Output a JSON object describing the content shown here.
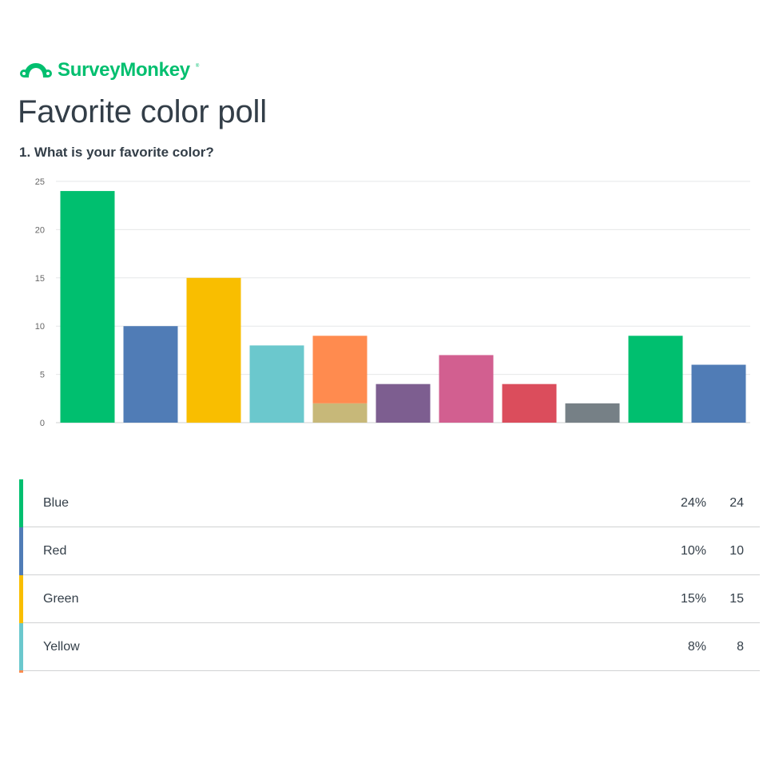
{
  "brand": {
    "name": "SurveyMonkey",
    "trademark": "®",
    "color": "#00bf6f"
  },
  "survey": {
    "title": "Favorite color poll",
    "question": "1. What is your favorite color?"
  },
  "chart_data": {
    "type": "bar",
    "stacked": true,
    "ylim": [
      0,
      25
    ],
    "yticks": [
      0,
      5,
      10,
      15,
      20,
      25
    ],
    "grid": true,
    "bars": [
      {
        "segments": [
          {
            "value": 24,
            "color": "#00bf6f"
          }
        ]
      },
      {
        "segments": [
          {
            "value": 10,
            "color": "#507cb6"
          }
        ]
      },
      {
        "segments": [
          {
            "value": 15,
            "color": "#f9be00"
          }
        ]
      },
      {
        "segments": [
          {
            "value": 8,
            "color": "#6bc8cd"
          }
        ]
      },
      {
        "segments": [
          {
            "value": 2,
            "color": "#c7b879"
          },
          {
            "value": 7,
            "color": "#ff8b4f"
          }
        ]
      },
      {
        "segments": [
          {
            "value": 4,
            "color": "#7d5e90"
          }
        ]
      },
      {
        "segments": [
          {
            "value": 7,
            "color": "#d25f90"
          }
        ]
      },
      {
        "segments": [
          {
            "value": 4,
            "color": "#db4d5c"
          }
        ]
      },
      {
        "segments": [
          {
            "value": 2,
            "color": "#768086"
          }
        ]
      },
      {
        "segments": [
          {
            "value": 9,
            "color": "#00bf6f"
          }
        ]
      },
      {
        "segments": [
          {
            "value": 6,
            "color": "#507cb6"
          }
        ]
      }
    ]
  },
  "legend": {
    "rows": [
      {
        "label": "Blue",
        "percent": "24%",
        "count": "24",
        "color": "#00bf6f"
      },
      {
        "label": "Red",
        "percent": "10%",
        "count": "10",
        "color": "#507cb6"
      },
      {
        "label": "Green",
        "percent": "15%",
        "count": "15",
        "color": "#f9be00"
      },
      {
        "label": "Yellow",
        "percent": "8%",
        "count": "8",
        "color": "#6bc8cd"
      }
    ],
    "next_color": "#ff8b4f"
  }
}
